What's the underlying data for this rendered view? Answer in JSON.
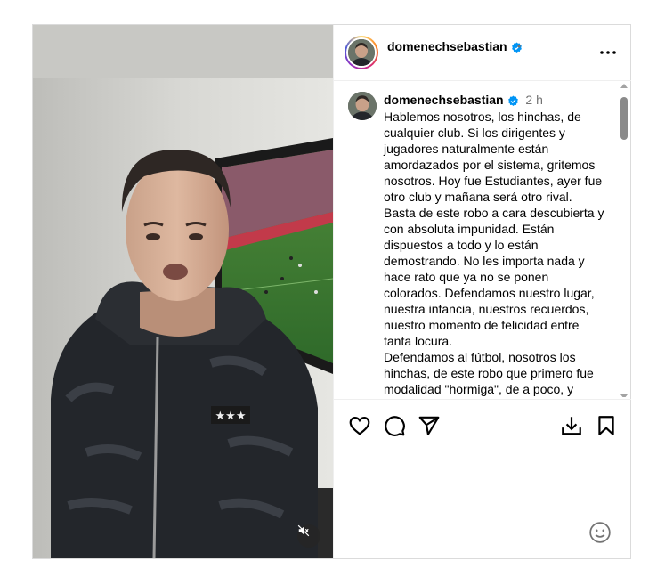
{
  "post": {
    "author": {
      "username": "domenechsebastian",
      "verified": true
    },
    "header": {
      "separator": "•",
      "more_icon": "more-horizontal-icon"
    },
    "caption": {
      "time": "2 h",
      "text": "Hablemos nosotros, los hinchas, de cualquier club. Si los dirigentes y jugadores naturalmente están amordazados por el sistema, gritemos nosotros. Hoy fue Estudiantes, ayer fue otro club y mañana será otro rival. Basta de este robo a cara descubierta y con absoluta impunidad. Están dispuestos a todo y lo están demostrando. No les importa nada y hace rato que ya no se ponen colorados. Defendamos nuestro lugar, nuestra infancia, nuestros recuerdos, nuestro momento de felicidad entre tanta locura.\nDefendamos al fútbol, nosotros los hinchas, de este robo que primero fue modalidad \"hormiga\", de a poco, y ahora es como una banda de asaltantes de banco. Quiero el sueño de que..."
    },
    "actions": {
      "like_icon": "heart-icon",
      "comment_icon": "comment-icon",
      "share_icon": "paper-plane-icon",
      "download_icon": "download-icon",
      "save_icon": "bookmark-icon",
      "emoji_icon": "smiley-icon"
    },
    "media": {
      "type": "video",
      "mute_icon": "speaker-muted-icon",
      "muted": true
    },
    "colors": {
      "verified_blue": "#0095f6",
      "border": "#dbdbdb",
      "muted_text": "#737373"
    }
  }
}
